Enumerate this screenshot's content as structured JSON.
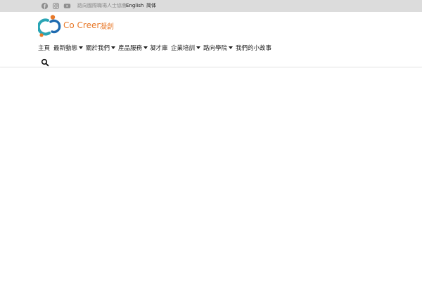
{
  "topbar": {
    "social": [
      "facebook-icon",
      "instagram-icon",
      "youtube-icon"
    ],
    "links": [
      {
        "label": "路向國際職場人士協會"
      },
      {
        "label": "English"
      },
      {
        "label": "简体"
      }
    ]
  },
  "brand": {
    "name": "Co Creer",
    "name_cn": "凝創",
    "colors": {
      "orange": "#e8792a",
      "teal": "#2aa5b5",
      "blue": "#1f6bb0"
    }
  },
  "nav": {
    "items": [
      {
        "label": "主頁",
        "dropdown": false
      },
      {
        "label": "最新動態",
        "dropdown": true
      },
      {
        "label": "關於我們",
        "dropdown": true
      },
      {
        "label": "產品服務",
        "dropdown": true
      },
      {
        "label": "凝才庫",
        "dropdown": false
      },
      {
        "label": "企業培訓",
        "dropdown": true
      },
      {
        "label": "路向學院",
        "dropdown": true
      },
      {
        "label": "我們的小故事",
        "dropdown": false
      }
    ],
    "search_icon": "search-icon"
  }
}
